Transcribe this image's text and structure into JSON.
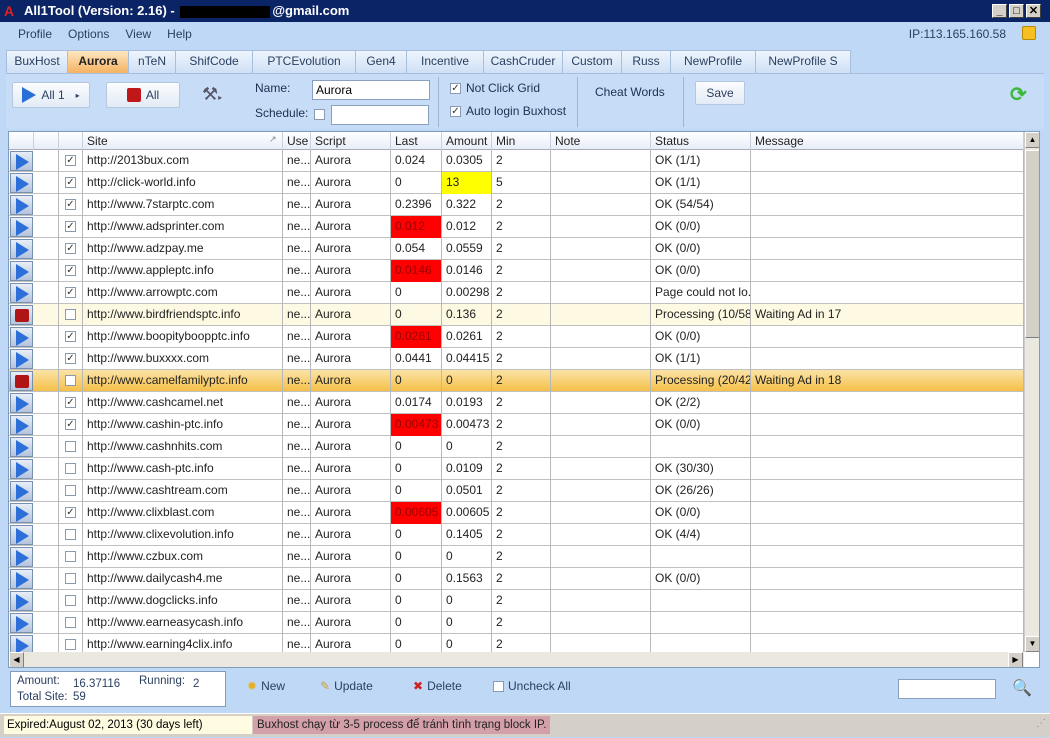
{
  "window": {
    "title_prefix": "All1Tool (Version: 2.16) - ",
    "title_suffix": "@gmail.com"
  },
  "menu": [
    "Profile",
    "Options",
    "View",
    "Help"
  ],
  "ip": "IP:113.165.160.58",
  "tabs": [
    "BuxHost",
    "Aurora",
    "nTeN",
    "ShifCode",
    "PTCEvolution",
    "Gen4",
    "Incentive",
    "CashCruder",
    "Custom",
    "Russ",
    "NewProfile",
    "NewProfile S"
  ],
  "active_tab": "Aurora",
  "toolbar": {
    "run_all": "All 1",
    "stop_all": "All",
    "name_label": "Name:",
    "name_value": "Aurora",
    "schedule_label": "Schedule:",
    "not_click_grid": "Not Click Grid",
    "auto_login": "Auto login Buxhost",
    "cheat_words": "Cheat Words",
    "save": "Save"
  },
  "columns": [
    "",
    "",
    "",
    "Site",
    "Use",
    "Script",
    "Last",
    "Amount",
    "Min",
    "Note",
    "Status",
    "Message"
  ],
  "colors": {
    "red": "#ff0000",
    "yellow": "#ffff00",
    "selected": "#f5c049"
  },
  "rows": [
    {
      "state": "play",
      "checked": true,
      "site": "http://2013bux.com",
      "use": "ne...",
      "script": "Aurora",
      "last": "0.024",
      "amount": "0.0305",
      "min": "2",
      "note": "",
      "status": "OK (1/1)",
      "message": ""
    },
    {
      "state": "play",
      "checked": true,
      "site": "http://click-world.info",
      "use": "ne...",
      "script": "Aurora",
      "last": "0",
      "amount": "13",
      "amount_hl": "yellow",
      "min": "5",
      "note": "",
      "status": "OK (1/1)",
      "message": ""
    },
    {
      "state": "play",
      "checked": true,
      "site": "http://www.7starptc.com",
      "use": "ne...",
      "script": "Aurora",
      "last": "0.2396",
      "amount": "0.322",
      "min": "2",
      "note": "",
      "status": "OK (54/54)",
      "message": ""
    },
    {
      "state": "play",
      "checked": true,
      "site": "http://www.adsprinter.com",
      "use": "ne...",
      "script": "Aurora",
      "last": "0.012",
      "last_hl": "red",
      "amount": "0.012",
      "min": "2",
      "note": "",
      "status": "OK (0/0)",
      "message": ""
    },
    {
      "state": "play",
      "checked": true,
      "site": "http://www.adzpay.me",
      "use": "ne...",
      "script": "Aurora",
      "last": "0.054",
      "amount": "0.0559",
      "min": "2",
      "note": "",
      "status": "OK (0/0)",
      "message": ""
    },
    {
      "state": "play",
      "checked": true,
      "site": "http://www.appleptc.info",
      "use": "ne...",
      "script": "Aurora",
      "last": "0.0146",
      "last_hl": "red",
      "amount": "0.0146",
      "min": "2",
      "note": "",
      "status": "OK (0/0)",
      "message": ""
    },
    {
      "state": "play",
      "checked": true,
      "site": "http://www.arrowptc.com",
      "use": "ne...",
      "script": "Aurora",
      "last": "0",
      "amount": "0.00298",
      "min": "2",
      "note": "",
      "status": "Page could not lo...",
      "message": ""
    },
    {
      "state": "stop",
      "checked": false,
      "row_style": "proc",
      "site": "http://www.birdfriendsptc.info",
      "use": "ne...",
      "script": "Aurora",
      "last": "0",
      "amount": "0.136",
      "min": "2",
      "note": "",
      "status": "Processing (10/58)",
      "message": "Waiting Ad in 17"
    },
    {
      "state": "play",
      "checked": true,
      "site": "http://www.boopityboopptc.info",
      "use": "ne...",
      "script": "Aurora",
      "last": "0.0261",
      "last_hl": "red",
      "amount": "0.0261",
      "min": "2",
      "note": "",
      "status": "OK (0/0)",
      "message": ""
    },
    {
      "state": "play",
      "checked": true,
      "site": "http://www.buxxxx.com",
      "use": "ne...",
      "script": "Aurora",
      "last": "0.0441",
      "amount": "0.04415",
      "min": "2",
      "note": "",
      "status": "OK (1/1)",
      "message": ""
    },
    {
      "state": "stop",
      "checked": false,
      "row_style": "sel",
      "site": "http://www.camelfamilyptc.info",
      "use": "ne...",
      "script": "Aurora",
      "last": "0",
      "amount": "0",
      "min": "2",
      "note": "",
      "status": "Processing (20/42)",
      "message": "Waiting Ad in 18"
    },
    {
      "state": "play",
      "checked": true,
      "site": "http://www.cashcamel.net",
      "use": "ne...",
      "script": "Aurora",
      "last": "0.0174",
      "amount": "0.0193",
      "min": "2",
      "note": "",
      "status": "OK (2/2)",
      "message": ""
    },
    {
      "state": "play",
      "checked": true,
      "site": "http://www.cashin-ptc.info",
      "use": "ne...",
      "script": "Aurora",
      "last": "0.00473",
      "last_hl": "red",
      "amount": "0.00473",
      "min": "2",
      "note": "",
      "status": "OK (0/0)",
      "message": ""
    },
    {
      "state": "play",
      "checked": false,
      "site": "http://www.cashnhits.com",
      "use": "ne...",
      "script": "Aurora",
      "last": "0",
      "amount": "0",
      "min": "2",
      "note": "",
      "status": "",
      "message": ""
    },
    {
      "state": "play",
      "checked": false,
      "site": "http://www.cash-ptc.info",
      "use": "ne...",
      "script": "Aurora",
      "last": "0",
      "amount": "0.0109",
      "min": "2",
      "note": "",
      "status": "OK (30/30)",
      "message": ""
    },
    {
      "state": "play",
      "checked": false,
      "site": "http://www.cashtream.com",
      "use": "ne...",
      "script": "Aurora",
      "last": "0",
      "amount": "0.0501",
      "min": "2",
      "note": "",
      "status": "OK (26/26)",
      "message": ""
    },
    {
      "state": "play",
      "checked": true,
      "site": "http://www.clixblast.com",
      "use": "ne...",
      "script": "Aurora",
      "last": "0.00605",
      "last_hl": "red",
      "amount": "0.00605",
      "min": "2",
      "note": "",
      "status": "OK (0/0)",
      "message": ""
    },
    {
      "state": "play",
      "checked": false,
      "site": "http://www.clixevolution.info",
      "use": "ne...",
      "script": "Aurora",
      "last": "0",
      "amount": "0.1405",
      "min": "2",
      "note": "",
      "status": "OK (4/4)",
      "message": ""
    },
    {
      "state": "play",
      "checked": false,
      "site": "http://www.czbux.com",
      "use": "ne...",
      "script": "Aurora",
      "last": "0",
      "amount": "0",
      "min": "2",
      "note": "",
      "status": "",
      "message": ""
    },
    {
      "state": "play",
      "checked": false,
      "site": "http://www.dailycash4.me",
      "use": "ne...",
      "script": "Aurora",
      "last": "0",
      "amount": "0.1563",
      "min": "2",
      "note": "",
      "status": "OK (0/0)",
      "message": ""
    },
    {
      "state": "play",
      "checked": false,
      "site": "http://www.dogclicks.info",
      "use": "ne...",
      "script": "Aurora",
      "last": "0",
      "amount": "0",
      "min": "2",
      "note": "",
      "status": "",
      "message": ""
    },
    {
      "state": "play",
      "checked": false,
      "site": "http://www.earneasycash.info",
      "use": "ne...",
      "script": "Aurora",
      "last": "0",
      "amount": "0",
      "min": "2",
      "note": "",
      "status": "",
      "message": ""
    },
    {
      "state": "play",
      "checked": false,
      "site": "http://www.earning4clix.info",
      "use": "ne...",
      "script": "Aurora",
      "last": "0",
      "amount": "0",
      "min": "2",
      "note": "",
      "status": "",
      "message": ""
    }
  ],
  "summary": {
    "amount_label": "Amount:",
    "amount": "16.37116",
    "running_label": "Running:",
    "running": "2",
    "total_label": "Total Site:",
    "total": "59"
  },
  "actions": {
    "new": "New",
    "update": "Update",
    "delete": "Delete",
    "uncheck_all": "Uncheck All"
  },
  "statusbar": {
    "expired": "Expired:August 02, 2013 (30 days left)",
    "notice": "Buxhost chạy từ 3-5 process để tránh tình trạng block IP."
  }
}
